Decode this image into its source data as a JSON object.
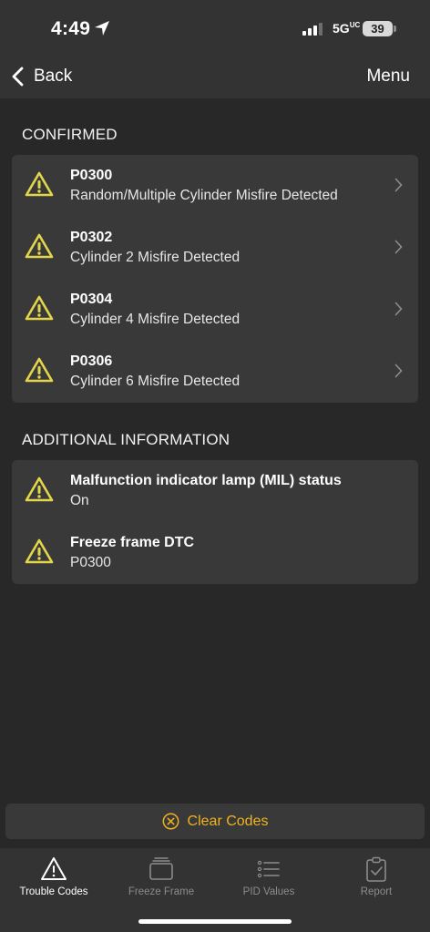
{
  "status_bar": {
    "time": "4:49",
    "network": "5G",
    "network_sup": "UC",
    "battery": "39"
  },
  "nav": {
    "back_label": "Back",
    "menu_label": "Menu"
  },
  "confirmed": {
    "title": "CONFIRMED",
    "items": [
      {
        "code": "P0300",
        "description": "Random/Multiple Cylinder Misfire Detected"
      },
      {
        "code": "P0302",
        "description": "Cylinder 2 Misfire Detected"
      },
      {
        "code": "P0304",
        "description": "Cylinder 4 Misfire Detected"
      },
      {
        "code": "P0306",
        "description": "Cylinder 6 Misfire Detected"
      }
    ]
  },
  "additional": {
    "title": "ADDITIONAL INFORMATION",
    "items": [
      {
        "label": "Malfunction indicator lamp (MIL) status",
        "value": "On"
      },
      {
        "label": "Freeze frame DTC",
        "value": "P0300"
      }
    ]
  },
  "clear_codes": {
    "label": "Clear Codes",
    "color": "#f0b21e"
  },
  "tabs": [
    {
      "label": "Trouble Codes",
      "icon": "warning-triangle-icon",
      "active": true
    },
    {
      "label": "Freeze Frame",
      "icon": "freeze-frame-icon",
      "active": false
    },
    {
      "label": "PID Values",
      "icon": "list-icon",
      "active": false
    },
    {
      "label": "Report",
      "icon": "clipboard-check-icon",
      "active": false
    }
  ],
  "colors": {
    "warning": "#e4d64b",
    "background": "#282828",
    "card": "#393939",
    "bar": "#333333"
  }
}
